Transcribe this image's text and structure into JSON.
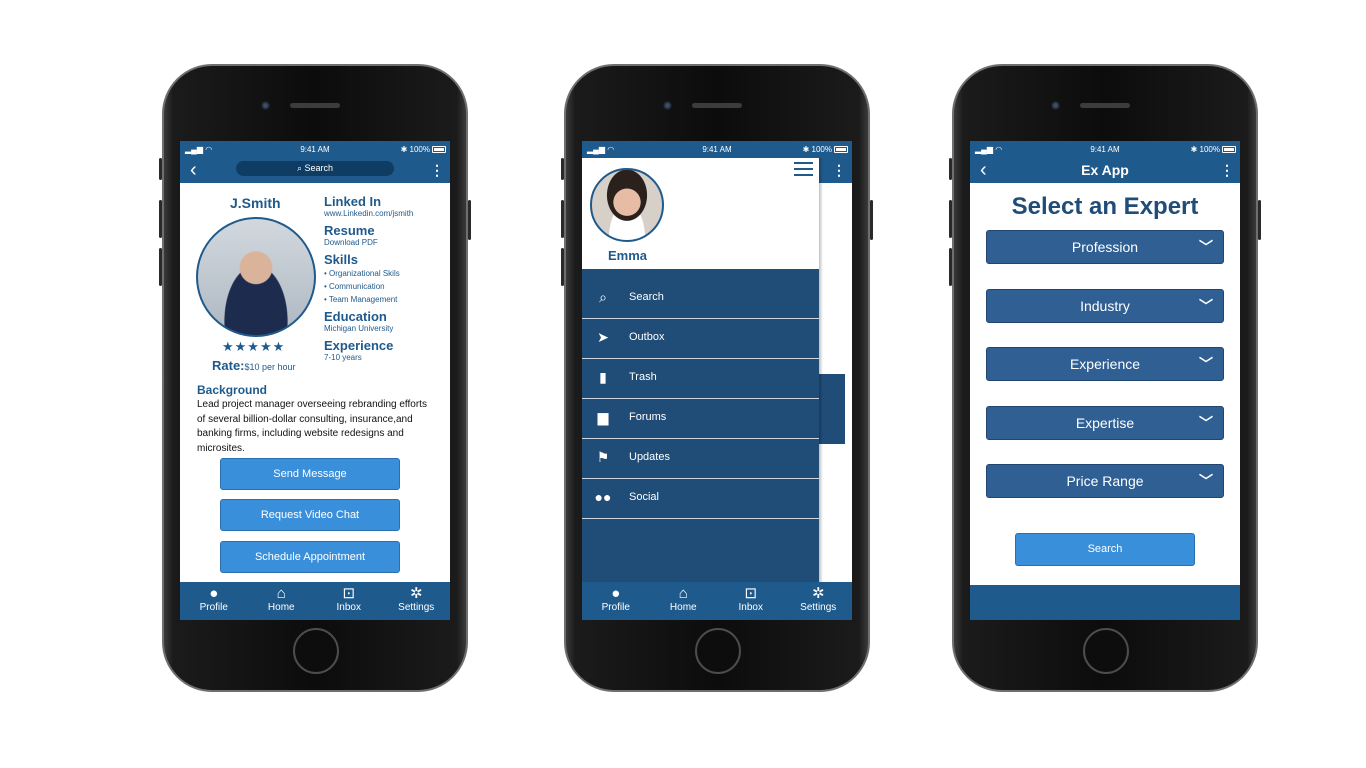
{
  "status": {
    "time": "9:41 AM",
    "battery": "100%"
  },
  "icons": {
    "back": "chevron-left-icon",
    "search": "search-icon",
    "more": "more-vertical-icon",
    "star": "star-icon",
    "hamburger": "hamburger-menu-icon",
    "chevron": "chevron-down-icon",
    "profile": "person-icon",
    "home": "home-icon",
    "inbox": "inbox-icon",
    "settings": "gear-icon"
  },
  "colors": {
    "primary": "#1f5a8c",
    "drawer": "#1f4d78",
    "button": "#3a8fdb"
  },
  "tabbar": {
    "profile": "Profile",
    "home": "Home",
    "inbox": "Inbox",
    "settings": "Settings"
  },
  "profile_screen": {
    "search_label": "Search",
    "name": "J.Smith",
    "stars": "★★★★★",
    "rating": 5,
    "rate_label": "Rate:",
    "rate_value": "$10 per hour",
    "linkedin": {
      "heading": "Linked In",
      "value": "www.Linkedin.com/jsmith"
    },
    "resume": {
      "heading": "Resume",
      "value": "Download PDF"
    },
    "skills": {
      "heading": "Skills",
      "items": [
        "• Organizational Skils",
        "• Communication",
        "• Team Management"
      ]
    },
    "education": {
      "heading": "Education",
      "value": "Michigan University"
    },
    "experience": {
      "heading": "Experience",
      "value": "7-10 years"
    },
    "background": {
      "heading": "Background",
      "text": "Lead project manager overseeing rebranding efforts of several billion-dollar consulting, insurance,and banking firms, including website redesigns and microsites."
    },
    "actions": {
      "send_message": "Send Message",
      "video_chat": "Request Video Chat",
      "schedule": "Schedule Appointment"
    }
  },
  "menu_screen": {
    "user_name": "Emma",
    "items": [
      {
        "label": "Search",
        "icon": "search-icon"
      },
      {
        "label": "Outbox",
        "icon": "send-icon"
      },
      {
        "label": "Trash",
        "icon": "trash-icon"
      },
      {
        "label": "Forums",
        "icon": "forum-icon"
      },
      {
        "label": "Updates",
        "icon": "flag-icon"
      },
      {
        "label": "Social",
        "icon": "people-icon"
      }
    ]
  },
  "expert_screen": {
    "app_title": "Ex App",
    "heading": "Select an Expert",
    "dropdowns": [
      "Profession",
      "Industry",
      "Experience",
      "Expertise",
      "Price Range"
    ],
    "search_label": "Search"
  }
}
